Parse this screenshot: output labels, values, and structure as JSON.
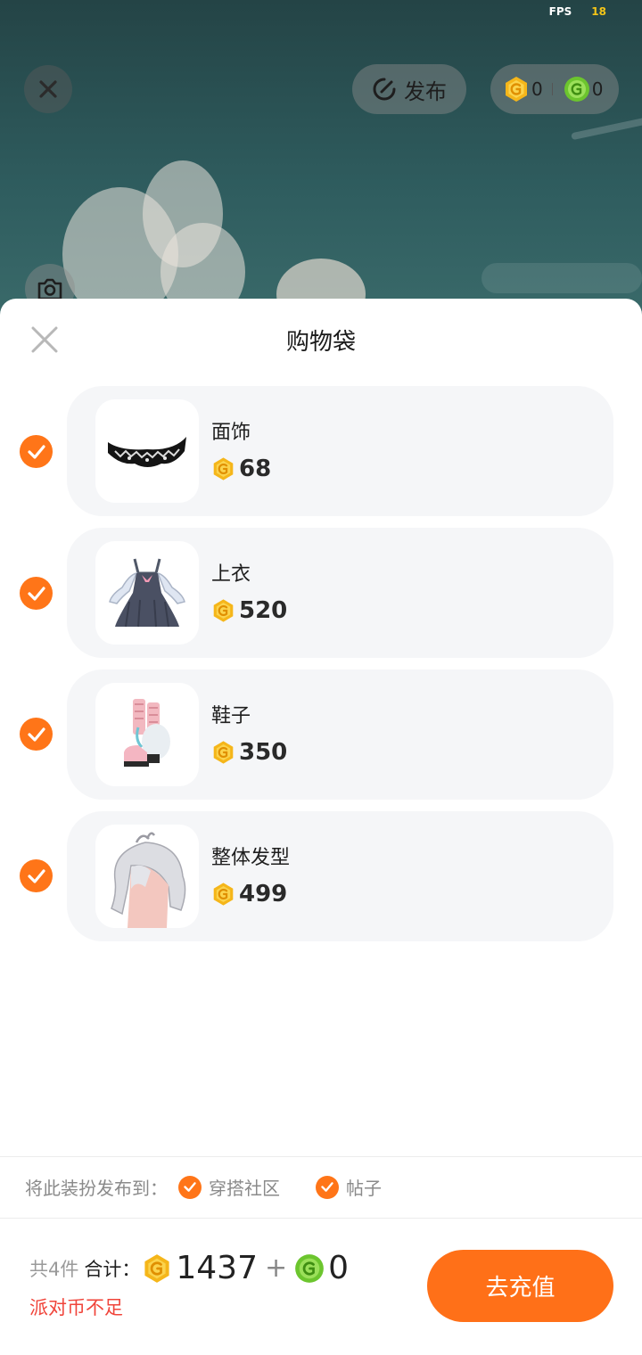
{
  "status": {
    "fps_label": "FPS",
    "fps_value": "18"
  },
  "top_bar": {
    "publish_label": "发布",
    "gold_balance": "0",
    "green_balance": "0"
  },
  "sheet": {
    "title": "购物袋",
    "items": [
      {
        "name": "面饰",
        "price": "68",
        "checked": true,
        "thumb": "face-accessory"
      },
      {
        "name": "上衣",
        "price": "520",
        "checked": true,
        "thumb": "dress-top"
      },
      {
        "name": "鞋子",
        "price": "350",
        "checked": true,
        "thumb": "shoes"
      },
      {
        "name": "整体发型",
        "price": "499",
        "checked": true,
        "thumb": "hairstyle"
      }
    ],
    "publish_to": {
      "label": "将此装扮发布到：",
      "options": [
        {
          "label": "穿搭社区",
          "checked": true
        },
        {
          "label": "帖子",
          "checked": true
        }
      ]
    },
    "footer": {
      "count_label": "共4件",
      "sum_label": "合计：",
      "gold_total": "1437",
      "plus": "+",
      "green_total": "0",
      "warning": "派对币不足",
      "recharge_label": "去充值"
    }
  },
  "colors": {
    "accent": "#ff7518",
    "gold_coin": "#f5b61a",
    "green_coin": "#6cc52e",
    "warning": "#f0443a"
  }
}
